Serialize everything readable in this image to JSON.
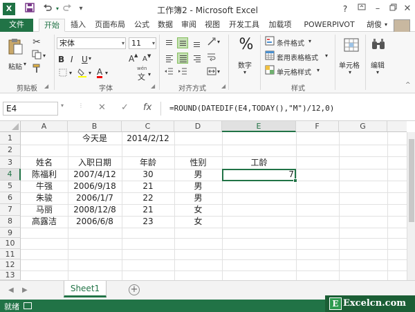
{
  "window": {
    "title": "工作簿2 - Microsoft Excel",
    "app_icon_glyph": "X",
    "quick_access": [
      "save-icon",
      "undo-icon",
      "redo-icon",
      "customize-icon"
    ],
    "controls": [
      "help-icon",
      "ribbon-display-icon",
      "minimize-icon",
      "restore-icon",
      "close-icon"
    ]
  },
  "tabs": [
    "文件",
    "开始",
    "插入",
    "页面布局",
    "公式",
    "数据",
    "审阅",
    "视图",
    "开发工具",
    "加载项",
    "POWERPIVOT",
    "胡俊"
  ],
  "active_tab": "开始",
  "ribbon": {
    "groups": {
      "clipboard": "剪贴板",
      "font": "字体",
      "alignment": "对齐方式",
      "styles": "样式"
    },
    "paste_label": "粘贴",
    "font_name": "宋体",
    "font_size": "11",
    "bold": "B",
    "italic": "I",
    "underline": "U",
    "grow_font": "A",
    "shrink_font": "A",
    "font_color": "A",
    "wen": "wén",
    "wen_char": "文",
    "number_label": "数字",
    "percent_glyph": "%",
    "cond_format": "条件格式",
    "table_format": "套用表格格式",
    "cell_styles": "单元格样式",
    "cells_label": "单元格",
    "editing_label": "编辑"
  },
  "formula_bar": {
    "name_box": "E4",
    "formula": "=ROUND(DATEDIF(E4,TODAY(),\"M\")/12,0)",
    "cancel": "✕",
    "enter": "✓",
    "fx": "fx"
  },
  "grid": {
    "columns": [
      "A",
      "B",
      "C",
      "D",
      "E",
      "F",
      "G"
    ],
    "rows": [
      "1",
      "2",
      "3",
      "4",
      "5",
      "6",
      "7",
      "8",
      "9",
      "10",
      "11",
      "12",
      "13"
    ],
    "cells": {
      "B1": "今天是",
      "C1": "2014/2/12",
      "A3": "姓名",
      "B3": "入职日期",
      "C3": "年龄",
      "D3": "性别",
      "E3": "工龄",
      "A4": "陈福利",
      "B4": "2007/4/12",
      "C4": "30",
      "D4": "男",
      "E4": "7",
      "A5": "牛强",
      "B5": "2006/9/18",
      "C5": "21",
      "D5": "男",
      "A6": "朱骏",
      "B6": "2006/1/7",
      "C6": "22",
      "D6": "男",
      "A7": "马丽",
      "B7": "2008/12/8",
      "C7": "21",
      "D7": "女",
      "A8": "高露洁",
      "B8": "2006/6/8",
      "C8": "23",
      "D8": "女"
    },
    "selected_cell": "E4"
  },
  "sheets": [
    "Sheet1"
  ],
  "add_sheet_glyph": "+",
  "status": "就绪",
  "watermark": {
    "glyph": "E",
    "text": "Excelcn.com"
  },
  "colors": {
    "accent": "#217346",
    "selection_fill": "#c5e0b4"
  }
}
